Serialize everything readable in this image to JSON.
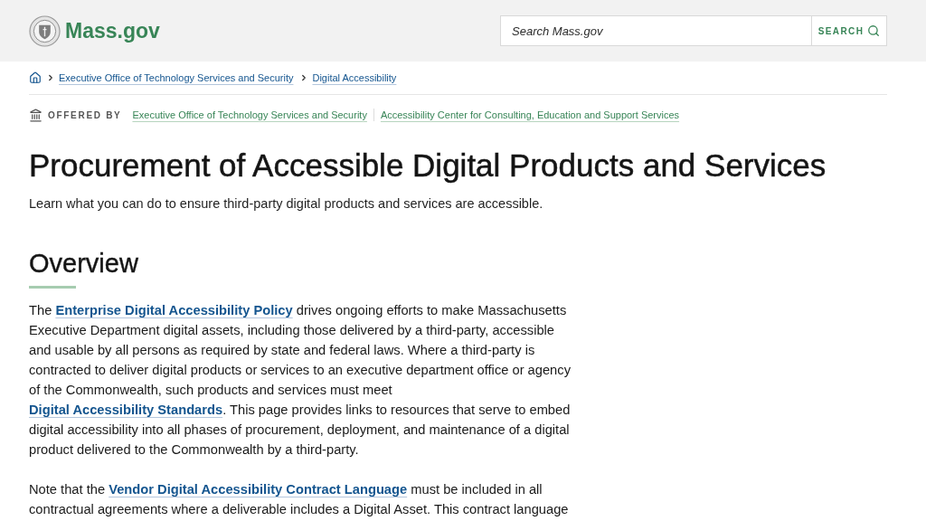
{
  "header": {
    "logo_text": "Mass.gov",
    "search": {
      "placeholder": "Search Mass.gov",
      "button": "SEARCH"
    }
  },
  "breadcrumb": [
    {
      "label": "Executive Office of Technology Services and Security"
    },
    {
      "label": "Digital Accessibility"
    }
  ],
  "offered_by": {
    "label": "OFFERED BY",
    "links": [
      "Executive Office of Technology Services and Security",
      "Accessibility Center for Consulting, Education and Support Services"
    ]
  },
  "title": "Procurement of Accessible Digital Products and Services",
  "lede": "Learn what you can do to ensure third-party digital products and services are accessible.",
  "sections": [
    {
      "heading": "Overview",
      "paragraphs": [
        [
          {
            "kind": "text",
            "text": "The "
          },
          {
            "kind": "link",
            "text": "Enterprise Digital Accessibility Policy"
          },
          {
            "kind": "text",
            "text": " drives ongoing efforts to make Massachusetts Executive Department digital assets, including those delivered by a third-party, accessible and usable by all persons as required by state and federal laws. Where a third-party is contracted to deliver digital products or services to an executive department office or agency of the Commonwealth, such products and services must meet "
          },
          {
            "kind": "link",
            "text": "Digital Accessibility Standards"
          },
          {
            "kind": "text",
            "text": ". This page provides links to resources that serve to embed digital accessibility into all phases of procurement, deployment, and maintenance of a digital product delivered to the Commonwealth by a third-party."
          }
        ],
        [
          {
            "kind": "text",
            "text": "Note that the "
          },
          {
            "kind": "link",
            "text": "Vendor Digital Accessibility Contract Language"
          },
          {
            "kind": "text",
            "text": " must be included in all contractual agreements where a deliverable includes a Digital Asset. This contract language"
          }
        ]
      ]
    }
  ]
}
